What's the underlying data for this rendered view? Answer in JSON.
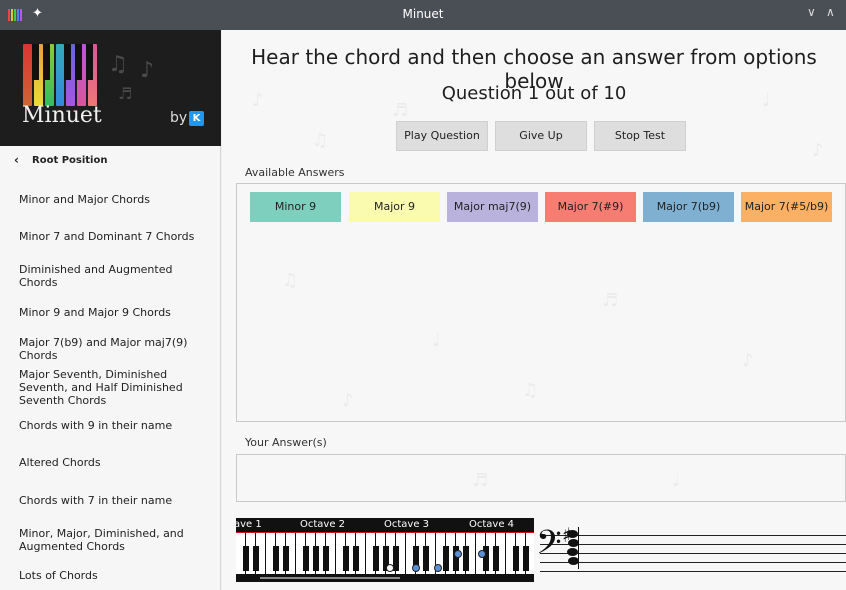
{
  "window": {
    "title": "Minuet",
    "minimize_glyph": "∨",
    "maximize_glyph": "∧",
    "pin_glyph": "✦"
  },
  "banner": {
    "app_name": "Minuet",
    "by_label": "by",
    "kde_label": "K"
  },
  "sidebar": {
    "back_label": "Root Position",
    "items": [
      "Minor and Major Chords",
      "Minor 7 and Dominant 7 Chords",
      "Diminished and Augmented Chords",
      "Minor 9 and Major 9 Chords",
      "Major 7(b9) and Major maj7(9) Chords",
      "Major Seventh, Diminished Seventh, and Half Diminished Seventh Chords",
      "Chords with 9 in their name",
      "Altered Chords",
      "Chords with 7 in their name",
      "Minor, Major, Diminished, and Augmented Chords",
      "Lots of Chords"
    ]
  },
  "main": {
    "instruction": "Hear the chord and then choose an answer from options below",
    "question": "Question 1 out of 10",
    "buttons": {
      "play": "Play Question",
      "give_up": "Give Up",
      "stop": "Stop Test"
    },
    "available_label": "Available Answers",
    "your_answers_label": "Your Answer(s)",
    "answers": [
      {
        "label": "Minor 9",
        "color": "#7fcfbf"
      },
      {
        "label": "Major 9",
        "color": "#fbfbb0"
      },
      {
        "label": "Major maj7(9)",
        "color": "#b9b2dc"
      },
      {
        "label": "Major 7(#9)",
        "color": "#f77d72"
      },
      {
        "label": "Major 7(b9)",
        "color": "#7fb0d2"
      },
      {
        "label": "Major 7(#5/b9)",
        "color": "#fbb063"
      }
    ]
  },
  "piano": {
    "octaves": [
      "ave 1",
      "Octave 2",
      "Octave 3",
      "Octave 4"
    ],
    "highlight_color": "#5b8fd6"
  },
  "colors": {
    "accent_red": "#dd1122",
    "titlebar": "#4a4e55"
  }
}
